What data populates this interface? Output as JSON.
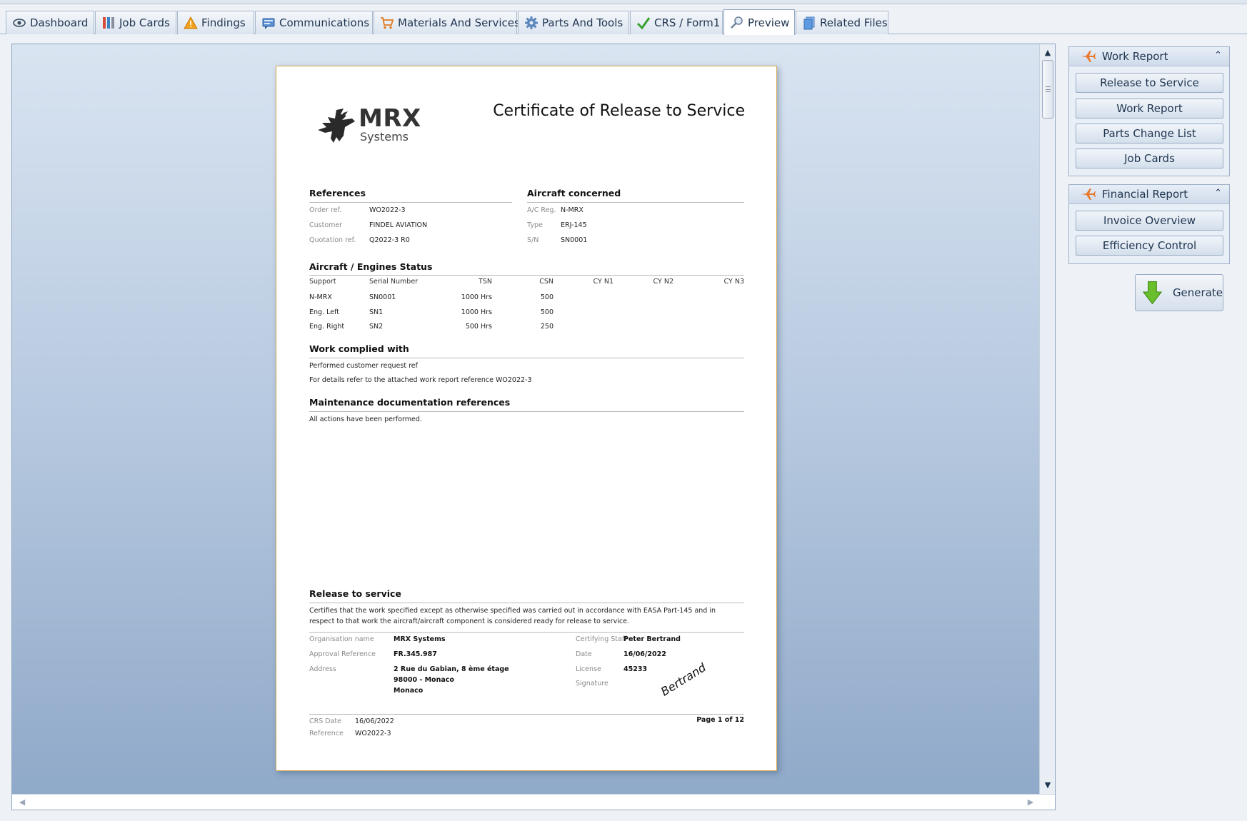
{
  "tabs": [
    {
      "label": "Dashboard",
      "icon": "eye-icon"
    },
    {
      "label": "Job Cards",
      "icon": "job-cards-icon"
    },
    {
      "label": "Findings",
      "icon": "warning-icon"
    },
    {
      "label": "Communications",
      "icon": "communications-icon"
    },
    {
      "label": "Materials And Services",
      "icon": "cart-icon"
    },
    {
      "label": "Parts And Tools",
      "icon": "gear-icon"
    },
    {
      "label": "CRS / Form1",
      "icon": "checkmark-icon"
    },
    {
      "label": "Preview",
      "icon": "magnifier-icon"
    },
    {
      "label": "Related Files",
      "icon": "files-icon"
    }
  ],
  "active_tab": "Preview",
  "document": {
    "logo_title": "MRX",
    "logo_subtitle": "Systems",
    "title": "Certificate of Release to Service",
    "references": {
      "heading": "References",
      "rows": [
        {
          "label": "Order ref.",
          "value": "WO2022-3"
        },
        {
          "label": "Customer",
          "value": "FINDEL AVIATION"
        },
        {
          "label": "Quotation ref.",
          "value": "Q2022-3 R0"
        }
      ]
    },
    "aircraft": {
      "heading": "Aircraft concerned",
      "rows": [
        {
          "label": "A/C Reg.",
          "value": "N-MRX"
        },
        {
          "label": "Type",
          "value": "ERJ-145"
        },
        {
          "label": "S/N",
          "value": "SN0001"
        }
      ]
    },
    "status": {
      "heading": "Aircraft / Engines Status",
      "columns": [
        "Support",
        "Serial Number",
        "TSN",
        "CSN",
        "CY N1",
        "CY N2",
        "CY N3"
      ],
      "rows": [
        [
          "N-MRX",
          "SN0001",
          "1000 Hrs",
          "500",
          "",
          "",
          ""
        ],
        [
          "Eng. Left",
          "SN1",
          "1000 Hrs",
          "500",
          "",
          "",
          ""
        ],
        [
          "Eng. Right",
          "SN2",
          "500 Hrs",
          "250",
          "",
          "",
          ""
        ]
      ]
    },
    "work": {
      "heading": "Work complied with",
      "lines": [
        "Performed customer request ref",
        "For details refer to the attached work report reference WO2022-3"
      ]
    },
    "maintenance": {
      "heading": "Maintenance documentation references",
      "text": "All actions have been performed."
    },
    "release": {
      "heading": "Release to service",
      "statement_1": "Certifies that the work specified except as otherwise specified was carried out in accordance with EASA Part-145 and in",
      "statement_2": "respect to that work the aircraft/aircraft component is considered ready for release to service.",
      "org_label": "Organisation name",
      "org_value": "MRX Systems",
      "approval_label": "Approval Reference",
      "approval_value": "FR.345.987",
      "address_label": "Address",
      "address_1": "2 Rue du Gabian, 8 ème étage",
      "address_2": "98000 - Monaco",
      "address_3": "Monaco",
      "staff_label": "Certifying Staff",
      "staff_value": "Peter Bertrand",
      "date_label": "Date",
      "date_value": "16/06/2022",
      "license_label": "License",
      "license_value": "45233",
      "signature_label": "Signature",
      "signature_text": "Bertrand"
    },
    "footer": {
      "crs_date_label": "CRS Date",
      "crs_date_value": "16/06/2022",
      "reference_label": "Reference",
      "reference_value": "WO2022-3",
      "page": "Page 1 of 12"
    }
  },
  "panel": {
    "work_report": {
      "title": "Work Report",
      "buttons": [
        "Release to Service",
        "Work Report",
        "Parts Change List",
        "Job Cards"
      ]
    },
    "financial_report": {
      "title": "Financial Report",
      "buttons": [
        "Invoice Overview",
        "Efficiency Control"
      ]
    },
    "generate_label": "Generate"
  },
  "colors": {
    "accent": "#1f3550",
    "page_border": "#d7a94e",
    "plane": "#e8782a",
    "generate_arrow": "#6cbf2c"
  }
}
